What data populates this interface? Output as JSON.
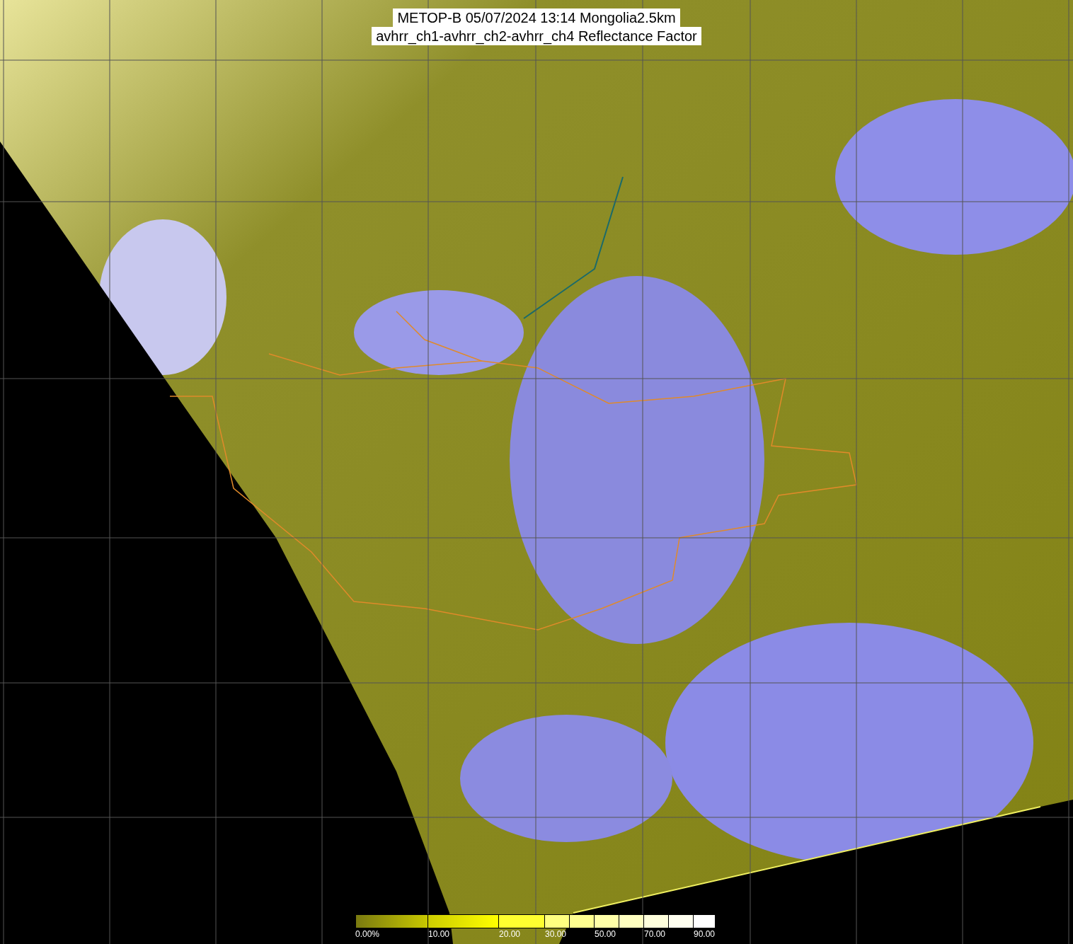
{
  "title": {
    "lines": [
      "METOP-B 05/07/2024 13:14 Mongolia2.5km",
      "avhrr_ch1-avhrr_ch2-avhrr_ch4 Reflectance Factor"
    ]
  },
  "legend": {
    "labels": [
      "0.00%",
      "10.00",
      "20.00",
      "30.00",
      "50.00",
      "70.00",
      "90.00"
    ]
  }
}
